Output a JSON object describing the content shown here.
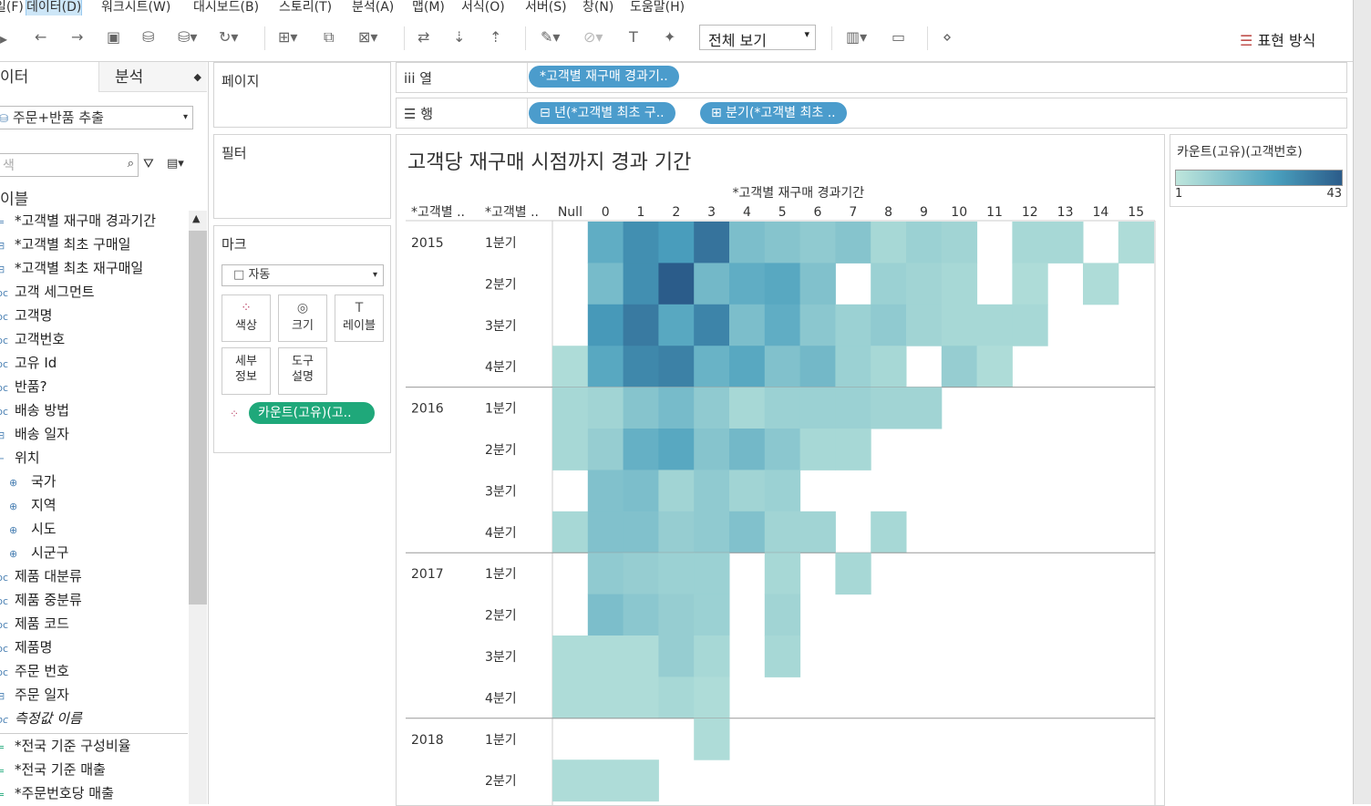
{
  "menu": [
    "일(F)",
    "데이터(D)",
    "워크시트(W)",
    "대시보드(B)",
    "스토리(T)",
    "분석(A)",
    "맵(M)",
    "서식(O)",
    "서버(S)",
    "창(N)",
    "도움말(H)"
  ],
  "toolbar": {
    "view_select": "전체 보기",
    "show_me": "표현 방식"
  },
  "left_panel": {
    "tab_data": "이터",
    "tab_analysis": "분석",
    "datasource": "주문+반품 추출",
    "search_placeholder": "색",
    "section_title": "이블",
    "fields": [
      {
        "icon": "=",
        "label": "*고객별 재구매 경과기간",
        "indent": false
      },
      {
        "icon": "⊟",
        "label": "*고객별 최초 구매일",
        "indent": false
      },
      {
        "icon": "⊟",
        "label": "*고객별 최초 재구매일",
        "indent": false
      },
      {
        "icon": "bc",
        "label": "고객 세그먼트",
        "indent": false
      },
      {
        "icon": "bc",
        "label": "고객명",
        "indent": false
      },
      {
        "icon": "bc",
        "label": "고객번호",
        "indent": false
      },
      {
        "icon": "bc",
        "label": "고유 Id",
        "indent": false
      },
      {
        "icon": "bc",
        "label": "반품?",
        "indent": false
      },
      {
        "icon": "bc",
        "label": "배송 방법",
        "indent": false
      },
      {
        "icon": "⊟",
        "label": "배송 일자",
        "indent": false
      },
      {
        "icon": "⌐",
        "label": "위치",
        "indent": false
      },
      {
        "icon": "⊕",
        "label": "국가",
        "indent": true
      },
      {
        "icon": "⊕",
        "label": "지역",
        "indent": true
      },
      {
        "icon": "⊕",
        "label": "시도",
        "indent": true
      },
      {
        "icon": "⊕",
        "label": "시군구",
        "indent": true
      },
      {
        "icon": "bc",
        "label": "제품 대분류",
        "indent": false
      },
      {
        "icon": "bc",
        "label": "제품 중분류",
        "indent": false
      },
      {
        "icon": "bc",
        "label": "제품 코드",
        "indent": false
      },
      {
        "icon": "bc",
        "label": "제품명",
        "indent": false
      },
      {
        "icon": "bc",
        "label": "주문 번호",
        "indent": false
      },
      {
        "icon": "⊟",
        "label": "주문 일자",
        "indent": false
      },
      {
        "icon": "bc",
        "label": "측정값 이름",
        "indent": false
      }
    ],
    "measures": [
      "*전국 기준 구성비율",
      "*전국 기준 매출",
      "*주문번호당 매출"
    ]
  },
  "shelves": {
    "pages": "페이지",
    "filters": "필터",
    "marks": "마크",
    "mark_type": "자동",
    "columns_label": "열",
    "rows_label": "행",
    "columns_pills": [
      "*고객별 재구매 경과기.."
    ],
    "rows_pills": [
      "⊟ 년(*고객별 최초 구..",
      "⊞ 분기(*고객별 최초 .."
    ],
    "mark_buttons": [
      {
        "label": "색상",
        "icon": "color-dots-icon"
      },
      {
        "label": "크기",
        "icon": "size-icon"
      },
      {
        "label": "레이블",
        "icon": "label-T-icon"
      },
      {
        "label": "세부\n정보",
        "icon": ""
      },
      {
        "label": "도구\n설명",
        "icon": ""
      }
    ],
    "color_pill": "카운트(고유)(고.."
  },
  "legend": {
    "title": "카운트(고유)(고객번호)",
    "min": "1",
    "max": "43",
    "color_low": "#bfe6dc",
    "color_high": "#2b5c8a"
  },
  "chart_data": {
    "type": "heatmap",
    "title": "고객당 재구매 시점까지 경과 기간",
    "column_header": "*고객별 재구매 경과기간",
    "row_headers": [
      "*고객별 ..",
      "*고객별 .."
    ],
    "columns": [
      "Null",
      "0",
      "1",
      "2",
      "3",
      "4",
      "5",
      "6",
      "7",
      "8",
      "9",
      "10",
      "11",
      "12",
      "13",
      "14",
      "15"
    ],
    "rows": [
      {
        "year": "2015",
        "quarter": "1분기",
        "values": [
          null,
          18,
          28,
          24,
          36,
          12,
          10,
          8,
          10,
          4,
          6,
          5,
          null,
          4,
          4,
          null,
          3
        ]
      },
      {
        "year": "",
        "quarter": "2분기",
        "values": [
          null,
          13,
          28,
          43,
          14,
          18,
          20,
          11,
          null,
          6,
          5,
          4,
          null,
          3,
          null,
          3,
          null
        ]
      },
      {
        "year": "",
        "quarter": "3분기",
        "values": [
          null,
          25,
          34,
          20,
          31,
          12,
          18,
          9,
          6,
          8,
          5,
          4,
          4,
          4,
          null,
          null,
          null
        ]
      },
      {
        "year": "",
        "quarter": "4분기",
        "values": [
          3,
          20,
          30,
          32,
          16,
          20,
          11,
          14,
          6,
          4,
          null,
          7,
          3,
          null,
          null,
          null,
          null
        ]
      },
      {
        "year": "2016",
        "quarter": "1분기",
        "values": [
          4,
          5,
          10,
          13,
          8,
          4,
          6,
          6,
          6,
          5,
          5,
          null,
          null,
          null,
          null,
          null,
          null
        ]
      },
      {
        "year": "",
        "quarter": "2분기",
        "values": [
          4,
          7,
          17,
          20,
          10,
          14,
          9,
          4,
          4,
          null,
          null,
          null,
          null,
          null,
          null,
          null,
          null
        ]
      },
      {
        "year": "",
        "quarter": "3분기",
        "values": [
          null,
          11,
          12,
          5,
          8,
          5,
          6,
          null,
          null,
          null,
          null,
          null,
          null,
          null,
          null,
          null,
          null
        ]
      },
      {
        "year": "",
        "quarter": "4분기",
        "values": [
          4,
          11,
          11,
          7,
          8,
          11,
          5,
          5,
          null,
          4,
          null,
          null,
          null,
          null,
          null,
          null,
          null
        ]
      },
      {
        "year": "2017",
        "quarter": "1분기",
        "values": [
          null,
          8,
          7,
          6,
          6,
          null,
          4,
          null,
          4,
          null,
          null,
          null,
          null,
          null,
          null,
          null,
          null
        ]
      },
      {
        "year": "",
        "quarter": "2분기",
        "values": [
          null,
          12,
          9,
          7,
          6,
          null,
          5,
          null,
          null,
          null,
          null,
          null,
          null,
          null,
          null,
          null,
          null
        ]
      },
      {
        "year": "",
        "quarter": "3분기",
        "values": [
          3,
          3,
          3,
          7,
          4,
          null,
          4,
          null,
          null,
          null,
          null,
          null,
          null,
          null,
          null,
          null,
          null
        ]
      },
      {
        "year": "",
        "quarter": "4분기",
        "values": [
          3,
          3,
          3,
          4,
          3,
          null,
          null,
          null,
          null,
          null,
          null,
          null,
          null,
          null,
          null,
          null,
          null
        ]
      },
      {
        "year": "2018",
        "quarter": "1분기",
        "values": [
          null,
          null,
          null,
          null,
          3,
          null,
          null,
          null,
          null,
          null,
          null,
          null,
          null,
          null,
          null,
          null,
          null
        ]
      },
      {
        "year": "",
        "quarter": "2분기",
        "values": [
          3,
          3,
          3,
          null,
          null,
          null,
          null,
          null,
          null,
          null,
          null,
          null,
          null,
          null,
          null,
          null,
          null
        ]
      }
    ],
    "color_min": 1,
    "color_max": 43
  }
}
